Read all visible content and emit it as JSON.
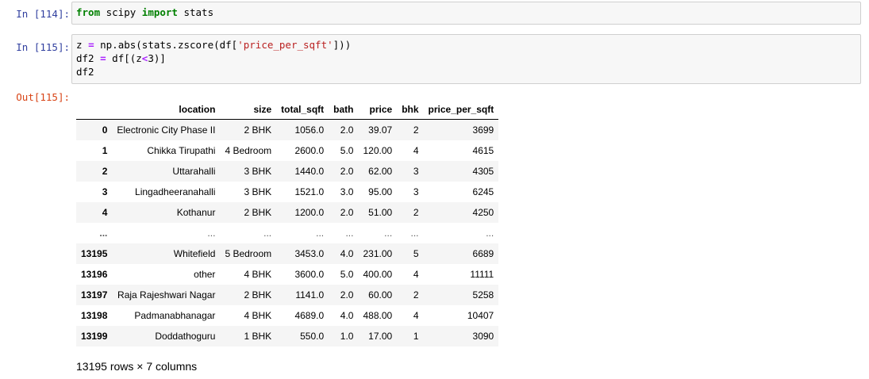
{
  "cells": [
    {
      "prompt": "In [114]:",
      "code_parts": [
        {
          "t": "from",
          "c": "kw"
        },
        {
          "t": " scipy ",
          "c": ""
        },
        {
          "t": "import",
          "c": "kw"
        },
        {
          "t": " stats",
          "c": ""
        }
      ]
    },
    {
      "prompt": "In [115]:",
      "code_parts": [
        {
          "t": "z ",
          "c": ""
        },
        {
          "t": "=",
          "c": "op"
        },
        {
          "t": " np.abs(stats.zscore(df[",
          "c": ""
        },
        {
          "t": "'price_per_sqft'",
          "c": "str"
        },
        {
          "t": "]))\ndf2 ",
          "c": ""
        },
        {
          "t": "=",
          "c": "op"
        },
        {
          "t": " df[(z",
          "c": ""
        },
        {
          "t": "<",
          "c": "op"
        },
        {
          "t": "3)]\ndf2",
          "c": ""
        }
      ]
    }
  ],
  "output": {
    "prompt": "Out[115]:",
    "columns": [
      "",
      "location",
      "size",
      "total_sqft",
      "bath",
      "price",
      "bhk",
      "price_per_sqft"
    ],
    "rows": [
      [
        "0",
        "Electronic City Phase II",
        "2 BHK",
        "1056.0",
        "2.0",
        "39.07",
        "2",
        "3699"
      ],
      [
        "1",
        "Chikka Tirupathi",
        "4 Bedroom",
        "2600.0",
        "5.0",
        "120.00",
        "4",
        "4615"
      ],
      [
        "2",
        "Uttarahalli",
        "3 BHK",
        "1440.0",
        "2.0",
        "62.00",
        "3",
        "4305"
      ],
      [
        "3",
        "Lingadheeranahalli",
        "3 BHK",
        "1521.0",
        "3.0",
        "95.00",
        "3",
        "6245"
      ],
      [
        "4",
        "Kothanur",
        "2 BHK",
        "1200.0",
        "2.0",
        "51.00",
        "2",
        "4250"
      ],
      [
        "...",
        "...",
        "...",
        "...",
        "...",
        "...",
        "...",
        "..."
      ],
      [
        "13195",
        "Whitefield",
        "5 Bedroom",
        "3453.0",
        "4.0",
        "231.00",
        "5",
        "6689"
      ],
      [
        "13196",
        "other",
        "4 BHK",
        "3600.0",
        "5.0",
        "400.00",
        "4",
        "11111"
      ],
      [
        "13197",
        "Raja Rajeshwari Nagar",
        "2 BHK",
        "1141.0",
        "2.0",
        "60.00",
        "2",
        "5258"
      ],
      [
        "13198",
        "Padmanabhanagar",
        "4 BHK",
        "4689.0",
        "4.0",
        "488.00",
        "4",
        "10407"
      ],
      [
        "13199",
        "Doddathoguru",
        "1 BHK",
        "550.0",
        "1.0",
        "17.00",
        "1",
        "3090"
      ]
    ],
    "footer": "13195 rows × 7 columns"
  },
  "colors": {
    "in_prompt": "#303F9F",
    "out_prompt": "#D84315",
    "keyword": "#008000",
    "string": "#BA2121"
  }
}
